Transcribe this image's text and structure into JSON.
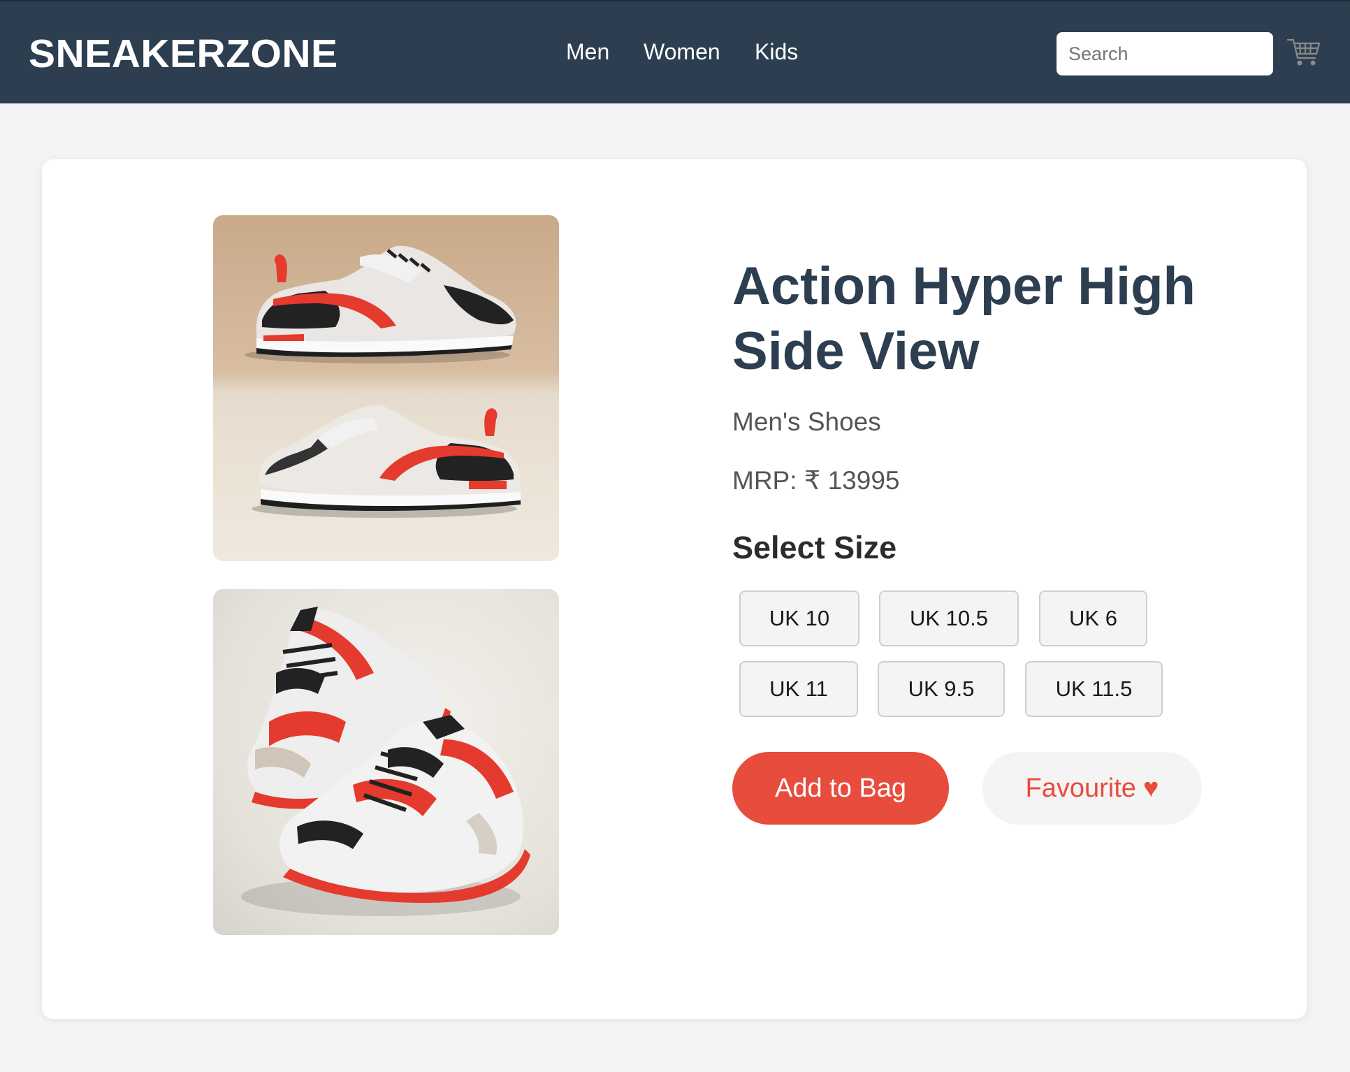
{
  "header": {
    "logo": "SNEAKERZONE",
    "nav": [
      "Men",
      "Women",
      "Kids"
    ],
    "search_placeholder": "Search",
    "cart_icon": "shopping-cart-icon"
  },
  "product": {
    "title_line1": "Action Hyper High",
    "title_line2": "Side View",
    "category": "Men's Shoes",
    "price": "MRP: ₹ 13995",
    "select_size_heading": "Select Size",
    "sizes": [
      "UK 10",
      "UK 10.5",
      "UK 6",
      "UK 11",
      "UK 9.5",
      "UK 11.5"
    ],
    "add_to_bag_label": "Add to Bag",
    "favourite_label": "Favourite",
    "favourite_icon": "heart-icon"
  },
  "colors": {
    "header_bg": "#2c3e50",
    "accent": "#e74c3c",
    "page_bg": "#f4f4f4"
  }
}
